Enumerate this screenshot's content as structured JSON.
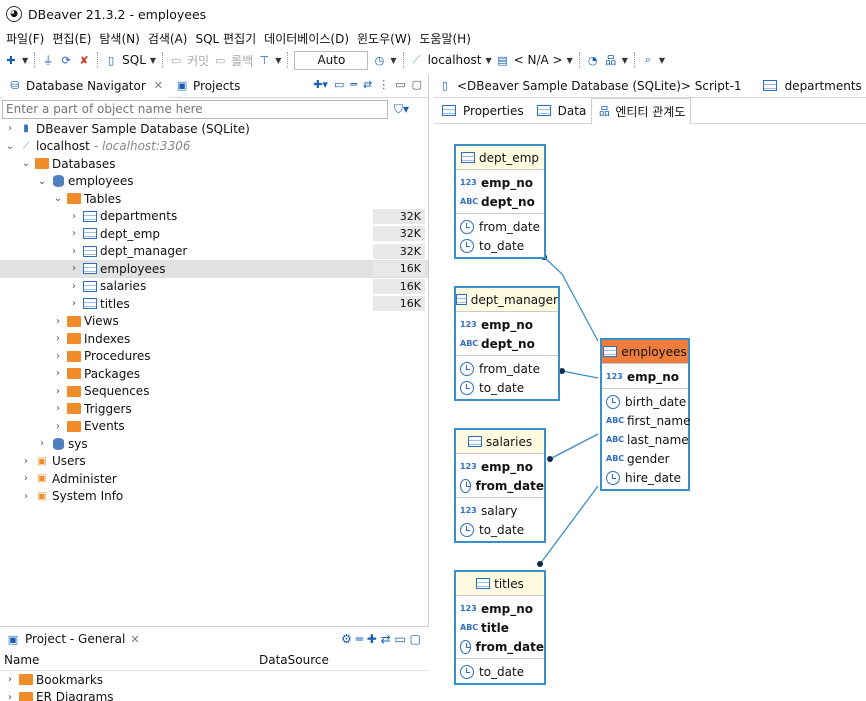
{
  "window": {
    "title": "DBeaver 21.3.2 - employees"
  },
  "menu": [
    "파일(F)",
    "편집(E)",
    "탐색(N)",
    "검색(A)",
    "SQL 편집기",
    "데이터베이스(D)",
    "윈도우(W)",
    "도움말(H)"
  ],
  "toolbar": {
    "sql_label": "SQL",
    "commit_label": "커밋",
    "rollback_label": "롤백",
    "tx_mode": "Auto",
    "datasource": "localhost",
    "schema": "< N/A >"
  },
  "navigator": {
    "tab_label": "Database Navigator",
    "projects_tab_label": "Projects",
    "filter_placeholder": "Enter a part of object name here",
    "tree": [
      {
        "label": "DBeaver Sample Database (SQLite)",
        "level": 0,
        "chev": "›",
        "icon": "sqlite-db-icon"
      },
      {
        "label": "localhost",
        "sub": "- localhost:3306",
        "level": 0,
        "chev": "⌄",
        "icon": "mysql-connection-icon"
      },
      {
        "label": "Databases",
        "level": 1,
        "chev": "⌄",
        "icon": "databases-folder-icon"
      },
      {
        "label": "employees",
        "level": 2,
        "chev": "⌄",
        "icon": "database-icon"
      },
      {
        "label": "Tables",
        "level": 3,
        "chev": "⌄",
        "icon": "tables-folder-icon"
      },
      {
        "label": "departments",
        "level": 4,
        "chev": "›",
        "icon": "table-icon",
        "size": "32K"
      },
      {
        "label": "dept_emp",
        "level": 4,
        "chev": "›",
        "icon": "table-icon",
        "size": "32K"
      },
      {
        "label": "dept_manager",
        "level": 4,
        "chev": "›",
        "icon": "table-icon",
        "size": "32K"
      },
      {
        "label": "employees",
        "level": 4,
        "chev": "›",
        "icon": "table-icon",
        "size": "16K",
        "selected": true
      },
      {
        "label": "salaries",
        "level": 4,
        "chev": "›",
        "icon": "table-icon",
        "size": "16K"
      },
      {
        "label": "titles",
        "level": 4,
        "chev": "›",
        "icon": "table-icon",
        "size": "16K"
      },
      {
        "label": "Views",
        "level": 3,
        "chev": "›",
        "icon": "views-folder-icon"
      },
      {
        "label": "Indexes",
        "level": 3,
        "chev": "›",
        "icon": "folder-icon"
      },
      {
        "label": "Procedures",
        "level": 3,
        "chev": "›",
        "icon": "folder-icon"
      },
      {
        "label": "Packages",
        "level": 3,
        "chev": "›",
        "icon": "folder-icon"
      },
      {
        "label": "Sequences",
        "level": 3,
        "chev": "›",
        "icon": "folder-icon"
      },
      {
        "label": "Triggers",
        "level": 3,
        "chev": "›",
        "icon": "folder-icon"
      },
      {
        "label": "Events",
        "level": 3,
        "chev": "›",
        "icon": "folder-icon"
      },
      {
        "label": "sys",
        "level": 2,
        "chev": "›",
        "icon": "database-icon"
      },
      {
        "label": "Users",
        "level": 1,
        "chev": "›",
        "icon": "users-icon"
      },
      {
        "label": "Administer",
        "level": 1,
        "chev": "›",
        "icon": "administer-icon"
      },
      {
        "label": "System Info",
        "level": 1,
        "chev": "›",
        "icon": "system-info-icon"
      }
    ]
  },
  "project": {
    "tab_label": "Project - General",
    "col_name": "Name",
    "col_datasource": "DataSource",
    "items": [
      "Bookmarks",
      "ER Diagrams"
    ]
  },
  "editor": {
    "tabs": [
      "<DBeaver Sample Database (SQLite)> Script-1",
      "departments"
    ],
    "sub_tabs": [
      "Properties",
      "Data",
      "엔티티 관계도"
    ]
  },
  "erd": {
    "entities": [
      {
        "id": "dept_emp",
        "title": "dept_emp",
        "keys": [
          {
            "type": "123",
            "name": "emp_no"
          },
          {
            "type": "ABC",
            "name": "dept_no"
          }
        ],
        "cols": [
          {
            "type": "clock",
            "name": "from_date"
          },
          {
            "type": "clock",
            "name": "to_date"
          }
        ]
      },
      {
        "id": "dept_manager",
        "title": "dept_manager",
        "keys": [
          {
            "type": "123",
            "name": "emp_no"
          },
          {
            "type": "ABC",
            "name": "dept_no"
          }
        ],
        "cols": [
          {
            "type": "clock",
            "name": "from_date"
          },
          {
            "type": "clock",
            "name": "to_date"
          }
        ]
      },
      {
        "id": "salaries",
        "title": "salaries",
        "keys": [
          {
            "type": "123",
            "name": "emp_no"
          },
          {
            "type": "clock",
            "name": "from_date"
          }
        ],
        "cols": [
          {
            "type": "123",
            "name": "salary"
          },
          {
            "type": "clock",
            "name": "to_date"
          }
        ]
      },
      {
        "id": "titles",
        "title": "titles",
        "keys": [
          {
            "type": "123",
            "name": "emp_no"
          },
          {
            "type": "ABC",
            "name": "title"
          },
          {
            "type": "clock",
            "name": "from_date"
          }
        ],
        "cols": [
          {
            "type": "clock",
            "name": "to_date"
          }
        ]
      },
      {
        "id": "employees",
        "title": "employees",
        "focus": true,
        "keys": [
          {
            "type": "123",
            "name": "emp_no"
          }
        ],
        "cols": [
          {
            "type": "clock",
            "name": "birth_date"
          },
          {
            "type": "ABC",
            "name": "first_name"
          },
          {
            "type": "ABC",
            "name": "last_name"
          },
          {
            "type": "ABC",
            "name": "gender"
          },
          {
            "type": "clock",
            "name": "hire_date"
          }
        ]
      }
    ]
  }
}
